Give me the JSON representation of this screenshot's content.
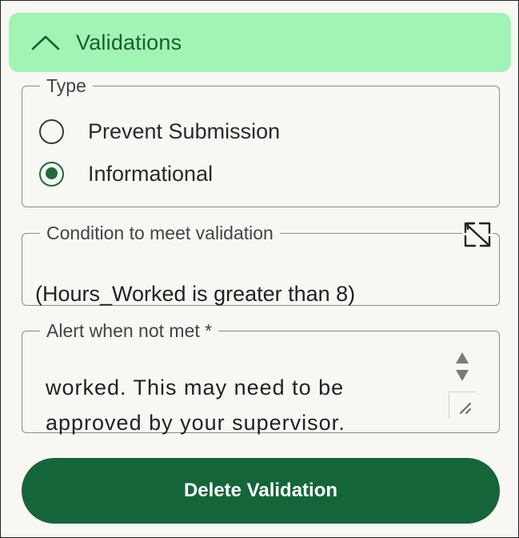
{
  "accordion": {
    "title": "Validations",
    "expanded": true
  },
  "type_group": {
    "legend": "Type",
    "options": [
      {
        "label": "Prevent Submission",
        "selected": false
      },
      {
        "label": "Informational",
        "selected": true
      }
    ]
  },
  "condition": {
    "legend": "Condition to meet validation",
    "value": "(Hours_Worked is greater than 8)"
  },
  "alert": {
    "legend": "Alert when not met *",
    "value": "worked. This may need to be\napproved by your supervisor."
  },
  "actions": {
    "delete_label": "Delete Validation"
  },
  "colors": {
    "header_bg": "#a2f4b5",
    "header_text": "#1e5b36",
    "accent": "#1c6b3a",
    "delete_bg": "#14663a"
  },
  "icons": {
    "collapse": "chevron-up-icon",
    "expand": "expand-diagonal-icon",
    "scroll": "spin-arrows-icon",
    "resize": "resize-handle-icon"
  }
}
